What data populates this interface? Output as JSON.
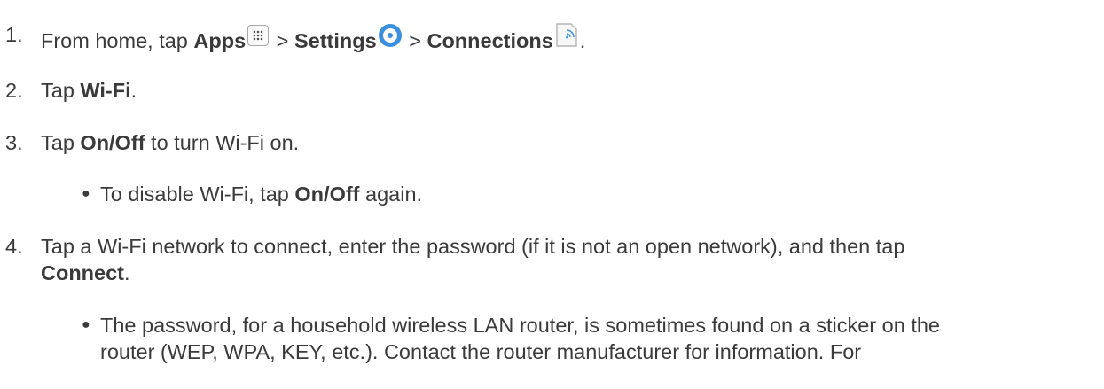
{
  "steps": [
    {
      "number": "1.",
      "parts": {
        "p1": "From home, tap ",
        "apps": "Apps",
        "sep1": " > ",
        "settings": "Settings",
        "sep2": " > ",
        "connections": "Connections",
        "end": "."
      }
    },
    {
      "number": "2.",
      "parts": {
        "p1": "Tap ",
        "wifi": "Wi-Fi",
        "end": "."
      }
    },
    {
      "number": "3.",
      "parts": {
        "p1": "Tap ",
        "onoff": "On/Off",
        "p2": " to turn Wi-Fi on."
      },
      "bullet": {
        "p1": "To disable Wi-Fi, tap ",
        "onoff": "On/Off",
        "p2": " again."
      }
    },
    {
      "number": "4.",
      "parts": {
        "p1": "Tap a Wi-Fi network to connect, enter the password (if it is not an open network), and then tap",
        "connect": "Connect",
        "end": "."
      },
      "bullet": {
        "line1": "The password, for a household wireless LAN router, is sometimes found on a sticker on the",
        "line2": "router (WEP, WPA, KEY, etc.). Contact the router manufacturer for information. For"
      }
    }
  ],
  "icons": {
    "apps": "apps-grid-icon",
    "settings": "settings-gear-icon",
    "connections": "connections-icon"
  },
  "colors": {
    "text": "#3a3a3a",
    "settings_icon": "#3d8fe0"
  }
}
